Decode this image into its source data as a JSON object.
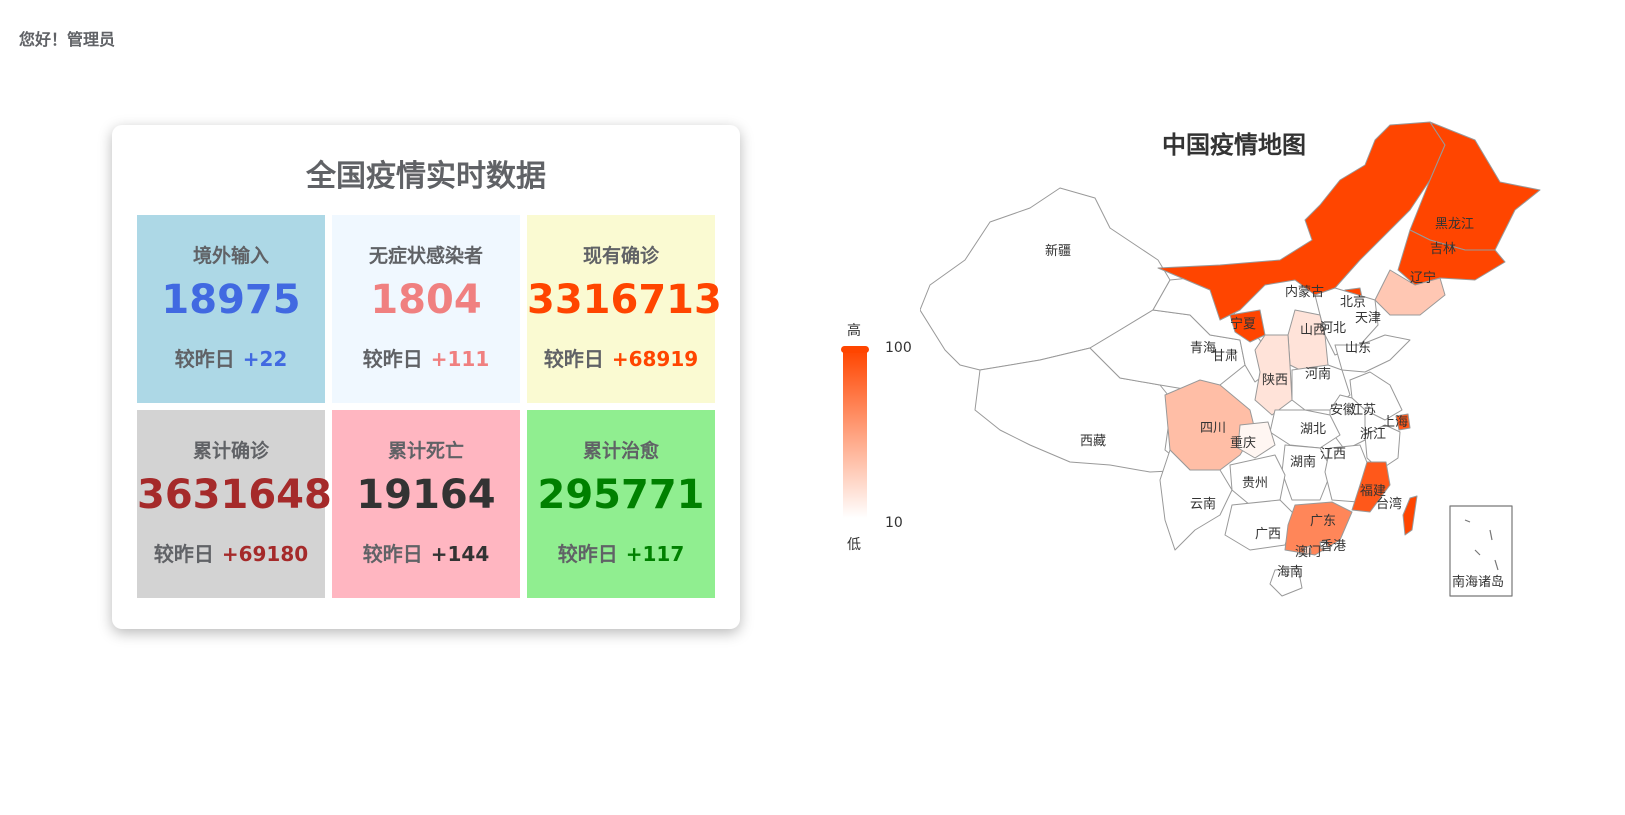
{
  "header": {
    "greeting": "您好！管理员"
  },
  "stats": {
    "title": "全国疫情实时数据",
    "delta_label": "较昨日",
    "cells": [
      {
        "label": "境外输入",
        "value": "18975",
        "delta": "+22",
        "bg": "#add8e6",
        "color": "#4169e1"
      },
      {
        "label": "无症状感染者",
        "value": "1804",
        "delta": "+111",
        "bg": "#f0f8ff",
        "color": "#f08080"
      },
      {
        "label": "现有确诊",
        "value": "3316713",
        "delta": "+68919",
        "bg": "#fafad2",
        "color": "#ff4500"
      },
      {
        "label": "累计确诊",
        "value": "3631648",
        "delta": "+69180",
        "bg": "#d3d3d3",
        "color": "#a52a2a"
      },
      {
        "label": "累计死亡",
        "value": "19164",
        "delta": "+144",
        "bg": "#ffb6c1",
        "color": "#333333"
      },
      {
        "label": "累计治愈",
        "value": "295771",
        "delta": "+117",
        "bg": "#90ee90",
        "color": "#008000"
      }
    ]
  },
  "map": {
    "title": "中国疫情地图",
    "legend": {
      "high_label": "高",
      "low_label": "低",
      "max": "100",
      "min": "10",
      "color_high": "#ff4500",
      "color_low": "#ffffff"
    },
    "provinces": [
      {
        "name": "新疆",
        "level": 0
      },
      {
        "name": "西藏",
        "level": 0
      },
      {
        "name": "青海",
        "level": 0
      },
      {
        "name": "甘肃",
        "level": 0
      },
      {
        "name": "内蒙古",
        "level": 1
      },
      {
        "name": "黑龙江",
        "level": 1
      },
      {
        "name": "吉林",
        "level": 1
      },
      {
        "name": "辽宁",
        "level": 0.3
      },
      {
        "name": "北京",
        "level": 1
      },
      {
        "name": "天津",
        "level": 0.2
      },
      {
        "name": "河北",
        "level": 0
      },
      {
        "name": "山西",
        "level": 0.15
      },
      {
        "name": "宁夏",
        "level": 1
      },
      {
        "name": "陕西",
        "level": 0.15
      },
      {
        "name": "山东",
        "level": 0
      },
      {
        "name": "河南",
        "level": 0
      },
      {
        "name": "江苏",
        "level": 0
      },
      {
        "name": "安徽",
        "level": 0
      },
      {
        "name": "上海",
        "level": 0.9
      },
      {
        "name": "浙江",
        "level": 0
      },
      {
        "name": "湖北",
        "level": 0
      },
      {
        "name": "四川",
        "level": 0.35
      },
      {
        "name": "重庆",
        "level": 0.05
      },
      {
        "name": "湖南",
        "level": 0
      },
      {
        "name": "江西",
        "level": 0
      },
      {
        "name": "福建",
        "level": 0.9
      },
      {
        "name": "台湾",
        "level": 1
      },
      {
        "name": "贵州",
        "level": 0
      },
      {
        "name": "云南",
        "level": 0
      },
      {
        "name": "广西",
        "level": 0
      },
      {
        "name": "广东",
        "level": 0.65
      },
      {
        "name": "澳门",
        "level": 0.2
      },
      {
        "name": "香港",
        "level": 0
      },
      {
        "name": "海南",
        "level": 0
      },
      {
        "name": "南海诸岛",
        "level": 0
      }
    ]
  }
}
